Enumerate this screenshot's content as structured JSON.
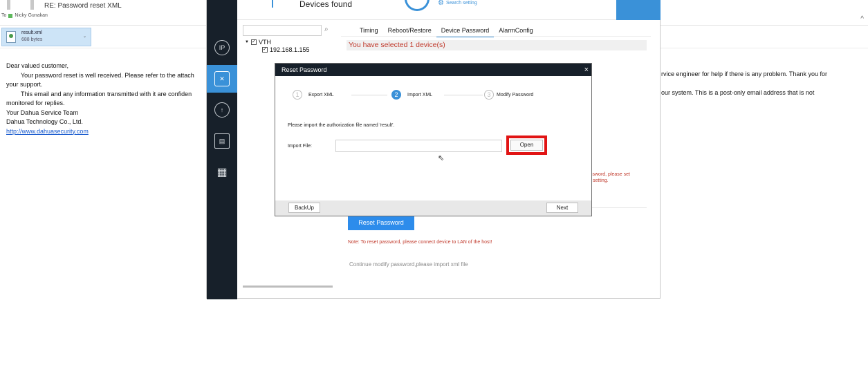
{
  "email": {
    "subject": "RE: Password reset XML",
    "to_label": "To",
    "recipient": "Nicky Gunakan",
    "collapse_glyph": "^",
    "attachment": {
      "name": "result.xml",
      "size": "688 bytes",
      "caret": "⌄"
    },
    "body": {
      "greeting": "Dear valued customer,",
      "line1": "Your password reset is well received. Please refer to the attach",
      "line1_right": "rvice engineer for help if there is any problem. Thank you for",
      "line2": "your support.",
      "line3": "This email and any information transmitted with it are confiden",
      "line3_right": "our system. This is a post-only email address that is not",
      "line4": "monitored for replies.",
      "sign1": "Your Dahua Service Team",
      "sign2": "Dahua Technology Co., Ltd.",
      "link": "http://www.dahuasecurity.com"
    }
  },
  "app": {
    "topbar": {
      "title": "Devices found",
      "search_setting": "Search setting"
    },
    "sidebar_icons": [
      "ip-icon",
      "tools-icon",
      "upgrade-icon",
      "layers-icon",
      "building-settings-icon"
    ],
    "tree": {
      "root": "VTH",
      "device": "192.168.1.155"
    },
    "tabs": [
      "Timing",
      "Reboot/Restore",
      "Device Password",
      "AlarmConfig"
    ],
    "selected_text": "You have selected 1 device(s)",
    "hint_red_1": "ssword, please set",
    "hint_red_2": "setting.",
    "reset_button": "Reset Password",
    "note": "Note: To reset password, please connect device to LAN of the host!",
    "continue_text": "Continue modify password,please import xml file"
  },
  "modal": {
    "title": "Reset Password",
    "close": "×",
    "steps": [
      {
        "num": "1",
        "label": "Export XML"
      },
      {
        "num": "2",
        "label": "Import XML"
      },
      {
        "num": "3",
        "label": "Modify Password"
      }
    ],
    "instruction": "Please import the authorization file named 'result'.",
    "import_label": "Import File:",
    "import_value": "",
    "open_button": "Open",
    "backup_button": "BackUp",
    "next_button": "Next"
  }
}
